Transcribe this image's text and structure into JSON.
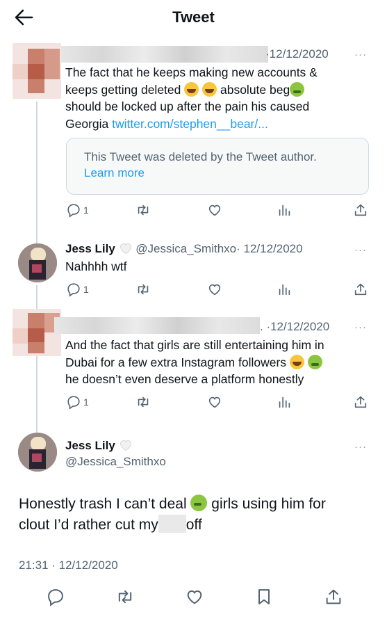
{
  "header": {
    "title": "Tweet"
  },
  "tweets": [
    {
      "date": "·12/12/2020",
      "more": "···",
      "line1": "The fact that he keeps making new accounts &",
      "line2_pre": "keeps getting deleted ",
      "line2_mid": " absolute beg",
      "line3": "should be locked up after the pain his caused",
      "line4_pre": "Georgia ",
      "link": "twitter.com/stephen__bear/...",
      "quote_text": "This Tweet was deleted by the Tweet author.",
      "quote_link": "Learn more",
      "reply_count": "1"
    },
    {
      "name": "Jess Lily",
      "handle": "@Jessica_Smithxo",
      "date": "· 12/12/2020",
      "more": "···",
      "text": "Nahhhh wtf",
      "reply_count": "1"
    },
    {
      "date": ". ·12/12/2020",
      "more": "···",
      "line1": "And the fact that girls are still entertaining him in",
      "line2": "Dubai for a few extra Instagram followers ",
      "line3": "he doesn’t even deserve a platform honestly",
      "reply_count": "1"
    }
  ],
  "main": {
    "name": "Jess Lily",
    "handle": "@Jessica_Smithxo",
    "more": "···",
    "text_a": "Honestly trash I can’t deal ",
    "text_b": " girls using him for",
    "text_c": "clout I’d rather cut my",
    "text_d": "off",
    "timestamp": "21:31 · 12/12/2020"
  },
  "icons": {
    "back": "arrow-left-icon",
    "reply": "reply-icon",
    "retweet": "retweet-icon",
    "like": "heart-icon",
    "views": "views-icon",
    "share": "share-icon",
    "bookmark": "bookmark-icon"
  },
  "colors": {
    "accent": "#1d9bf0",
    "muted": "#536471",
    "border": "#cfd9de"
  }
}
